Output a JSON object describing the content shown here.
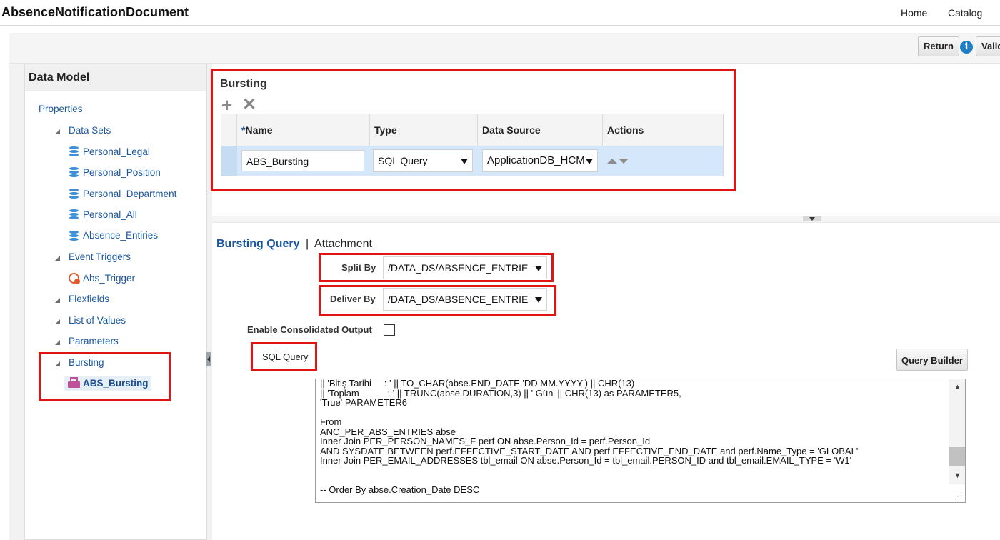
{
  "header": {
    "title": "AbsenceNotificationDocument",
    "links": [
      "Home",
      "Catalog"
    ]
  },
  "toolbar": {
    "return_label": "Return",
    "validate_label": "Validate",
    "info_glyph": "i"
  },
  "left": {
    "title": "Data Model",
    "properties": "Properties",
    "data_sets": "Data Sets",
    "data_set_items": [
      "Personal_Legal",
      "Personal_Position",
      "Personal_Department",
      "Personal_All",
      "Absence_Entiries"
    ],
    "event_triggers": "Event Triggers",
    "trigger_items": [
      "Abs_Trigger"
    ],
    "flexfields": "Flexfields",
    "list_of_values": "List of Values",
    "parameters": "Parameters",
    "bursting": "Bursting",
    "bursting_items": [
      "ABS_Bursting"
    ]
  },
  "bursting": {
    "title": "Bursting",
    "add_glyph": "+",
    "delete_glyph": "✕",
    "columns": {
      "required_mark": "*",
      "name": "Name",
      "type": "Type",
      "data_source": "Data Source",
      "actions": "Actions"
    },
    "row": {
      "name": "ABS_Bursting",
      "type": "SQL Query",
      "data_source": "ApplicationDB_HCM"
    }
  },
  "query": {
    "tab_bursting_query": "Bursting Query",
    "tab_separator": "|",
    "tab_attachment": "Attachment",
    "split_by_label": "Split By",
    "split_by_value": "/DATA_DS/ABSENCE_ENTRIE",
    "deliver_by_label": "Deliver By",
    "deliver_by_value": "/DATA_DS/ABSENCE_ENTRIE",
    "enable_consolidated_label": "Enable Consolidated Output",
    "enable_consolidated_checked": false,
    "sql_query_label": "SQL Query",
    "query_builder_label": "Query Builder",
    "sql_lines": [
      "|| 'Bitiş Tarihi     : ' || TO_CHAR(abse.END_DATE,'DD.MM.YYYY') || CHR(13)",
      "|| 'Toplam           : ' || TRUNC(abse.DURATION,3) || ' Gün' || CHR(13) as PARAMETER5,",
      "'True' PARAMETER6",
      "",
      "From",
      "ANC_PER_ABS_ENTRIES abse",
      "Inner Join PER_PERSON_NAMES_F perf ON abse.Person_Id = perf.Person_Id",
      "AND SYSDATE BETWEEN perf.EFFECTIVE_START_DATE AND perf.EFFECTIVE_END_DATE and perf.Name_Type = 'GLOBAL'",
      "Inner Join PER_EMAIL_ADDRESSES tbl_email ON abse.Person_Id = tbl_email.PERSON_ID and tbl_email.EMAIL_TYPE = 'W1'",
      "",
      "",
      "-- Order By abse.Creation_Date DESC"
    ]
  },
  "colors": {
    "highlight_red": "#e11414",
    "link_blue": "#1a57a0",
    "row_selected": "#d4e7fb"
  }
}
